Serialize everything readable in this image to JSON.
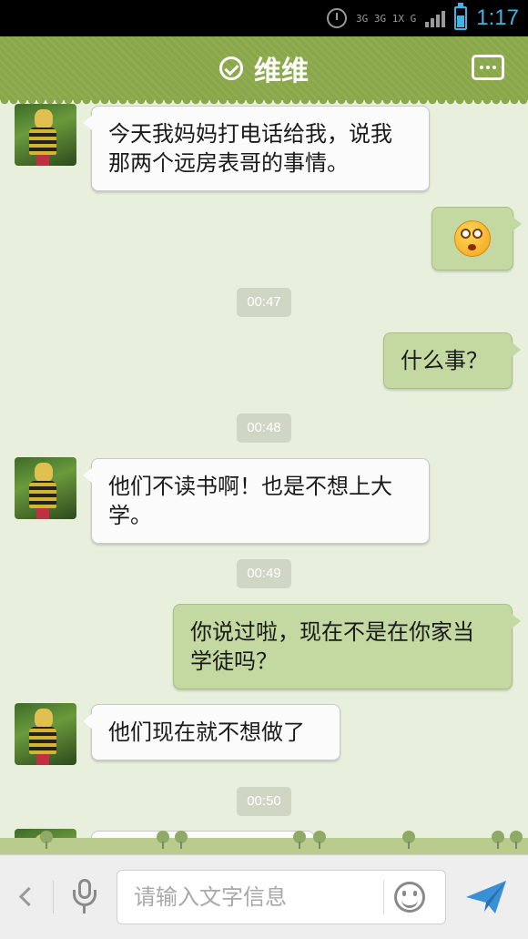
{
  "status_bar": {
    "network_text": "3G 3G 1X G",
    "time": "1:17"
  },
  "header": {
    "title": "维维",
    "status_icon": "check-circle-icon",
    "menu_icon": "more-dots-icon"
  },
  "messages": [
    {
      "side": "left",
      "text": "今天我妈妈打电话给我，说我那两个远房表哥的事情。"
    },
    {
      "side": "right",
      "type": "emoji",
      "emoji": "surprised-face"
    },
    {
      "side": "time",
      "text": "00:47"
    },
    {
      "side": "right",
      "text": "什么事？"
    },
    {
      "side": "time",
      "text": "00:48"
    },
    {
      "side": "left",
      "text": "他们不读书啊！也是不想上大学。"
    },
    {
      "side": "time",
      "text": "00:49"
    },
    {
      "side": "right",
      "text": "你说过啦，现在不是在你家当学徒吗？"
    },
    {
      "side": "left",
      "text": "他们现在就不想做了"
    },
    {
      "side": "time",
      "text": "00:50"
    },
    {
      "side": "left",
      "text": ""
    }
  ],
  "input_bar": {
    "placeholder": "请输入文字信息",
    "value": ""
  },
  "colors": {
    "header_bg": "#8aa84a",
    "chat_bg": "#e8efdc",
    "bubble_left": "#fbfbfb",
    "bubble_right": "#c4d8a2",
    "time_chip": "#cfd6c4",
    "accent_blue": "#3fb4e5"
  }
}
